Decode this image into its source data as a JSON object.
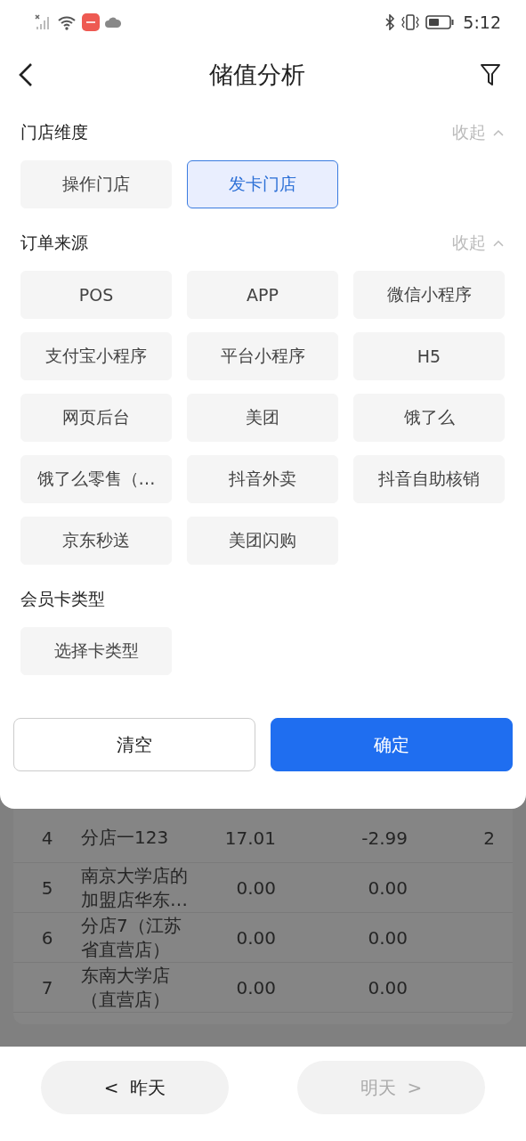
{
  "status_bar": {
    "time": "5:12"
  },
  "header": {
    "title": "储值分析"
  },
  "filter_sections": [
    {
      "title": "门店维度",
      "collapse_label": "收起",
      "options": [
        {
          "label": "操作门店",
          "selected": false
        },
        {
          "label": "发卡门店",
          "selected": true
        }
      ]
    },
    {
      "title": "订单来源",
      "collapse_label": "收起",
      "options": [
        {
          "label": "POS",
          "selected": false
        },
        {
          "label": "APP",
          "selected": false
        },
        {
          "label": "微信小程序",
          "selected": false
        },
        {
          "label": "支付宝小程序",
          "selected": false
        },
        {
          "label": "平台小程序",
          "selected": false
        },
        {
          "label": "H5",
          "selected": false
        },
        {
          "label": "网页后台",
          "selected": false
        },
        {
          "label": "美团",
          "selected": false
        },
        {
          "label": "饿了么",
          "selected": false
        },
        {
          "label": "饿了么零售（…",
          "selected": false
        },
        {
          "label": "抖音外卖",
          "selected": false
        },
        {
          "label": "抖音自助核销",
          "selected": false
        },
        {
          "label": "京东秒送",
          "selected": false
        },
        {
          "label": "美团闪购",
          "selected": false
        }
      ]
    },
    {
      "title": "会员卡类型",
      "options": [
        {
          "label": "选择卡类型",
          "selected": false
        }
      ]
    }
  ],
  "actions": [
    {
      "label": "清空",
      "kind": "secondary"
    },
    {
      "label": "确定",
      "kind": "primary"
    }
  ],
  "table": {
    "rows": [
      {
        "index": "4",
        "name": "分店一123",
        "column_3": "17.01",
        "column_4": "-2.99",
        "column_5": "2"
      },
      {
        "index": "5",
        "name": "南京大学店的加盟店华东…",
        "column_3": "0.00",
        "column_4": "0.00"
      },
      {
        "index": "6",
        "name": "分店7（江苏省直营店）",
        "column_3": "0.00",
        "column_4": "0.00"
      },
      {
        "index": "7",
        "name": "东南大学店（直营店）",
        "column_3": "0.00",
        "column_4": "0.00"
      }
    ]
  },
  "day_nav": [
    {
      "label": "<  昨天",
      "disabled": false
    },
    {
      "label": "明天  >",
      "disabled": true
    }
  ]
}
